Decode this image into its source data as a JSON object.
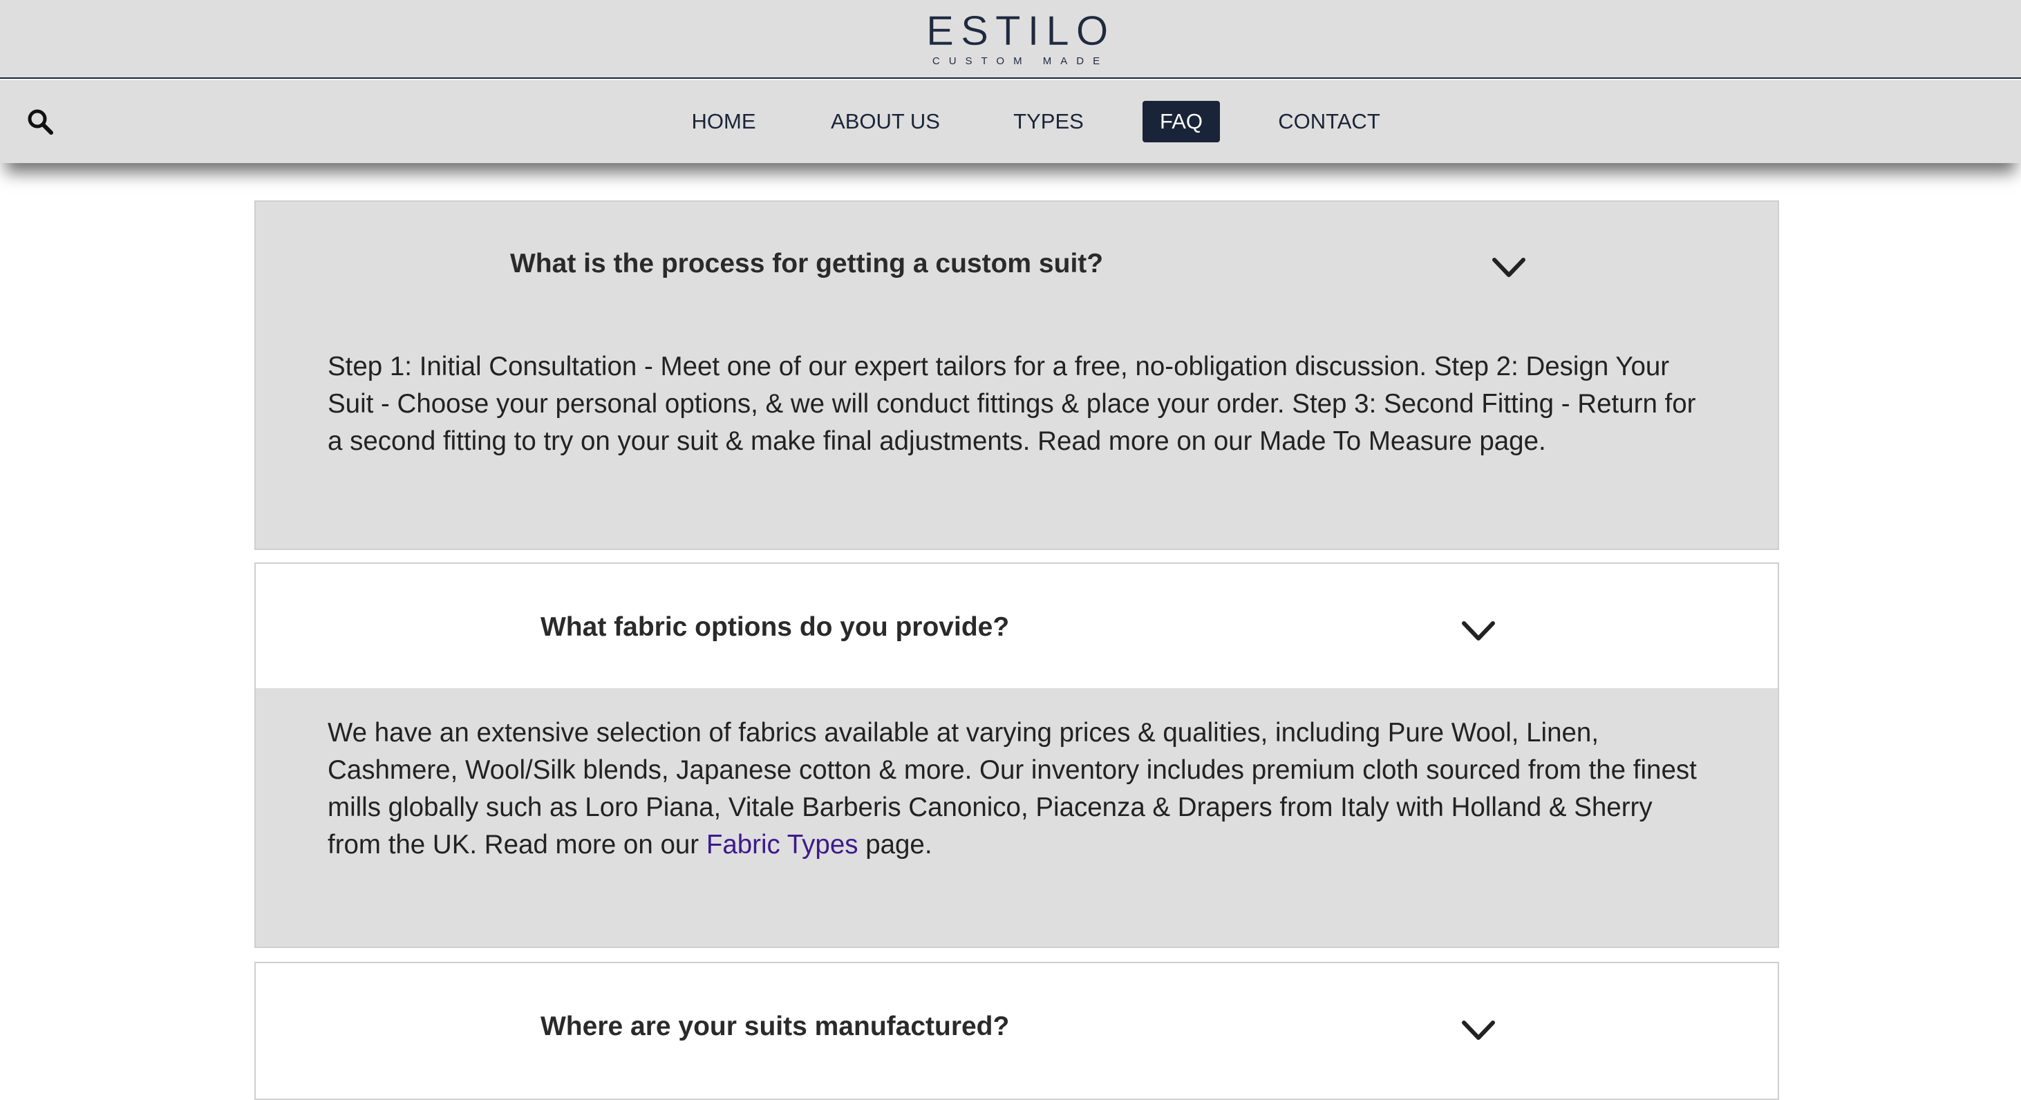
{
  "brand": {
    "name": "ESTILO",
    "tagline": "CUSTOM MADE"
  },
  "nav": {
    "items": [
      {
        "label": "HOME"
      },
      {
        "label": "ABOUT US"
      },
      {
        "label": "TYPES"
      },
      {
        "label": "FAQ",
        "active": true
      },
      {
        "label": "CONTACT"
      }
    ]
  },
  "icons": {
    "search": "search-icon",
    "chevron": "chevron-down-icon"
  },
  "colors": {
    "navy": "#1a2438",
    "panel_gray": "#dedede",
    "link_purple": "#3d1a8a"
  },
  "faq": [
    {
      "question": "What is the process for getting a custom suit?",
      "answer": "Step 1: Initial Consultation - Meet one of our expert tailors for a free, no-obligation discussion. Step 2: Design Your Suit - Choose your personal options, & we will conduct fittings & place your order. Step 3: Second Fitting - Return for a second fitting to try on your suit & make final adjustments. Read more on our Made To Measure page."
    },
    {
      "question": "What fabric options do you provide?",
      "answer_before": "We have an extensive selection of fabrics available at varying prices & qualities, including Pure Wool, Linen, Cashmere, Wool/Silk blends, Japanese cotton & more. Our inventory includes premium cloth sourced from the finest mills globally such as Loro Piana, Vitale Barberis Canonico, Piacenza & Drapers from Italy with Holland & Sherry from the UK. Read more on our ",
      "answer_link": "Fabric Types",
      "answer_after": " page."
    },
    {
      "question": "Where are your suits manufactured?"
    }
  ]
}
